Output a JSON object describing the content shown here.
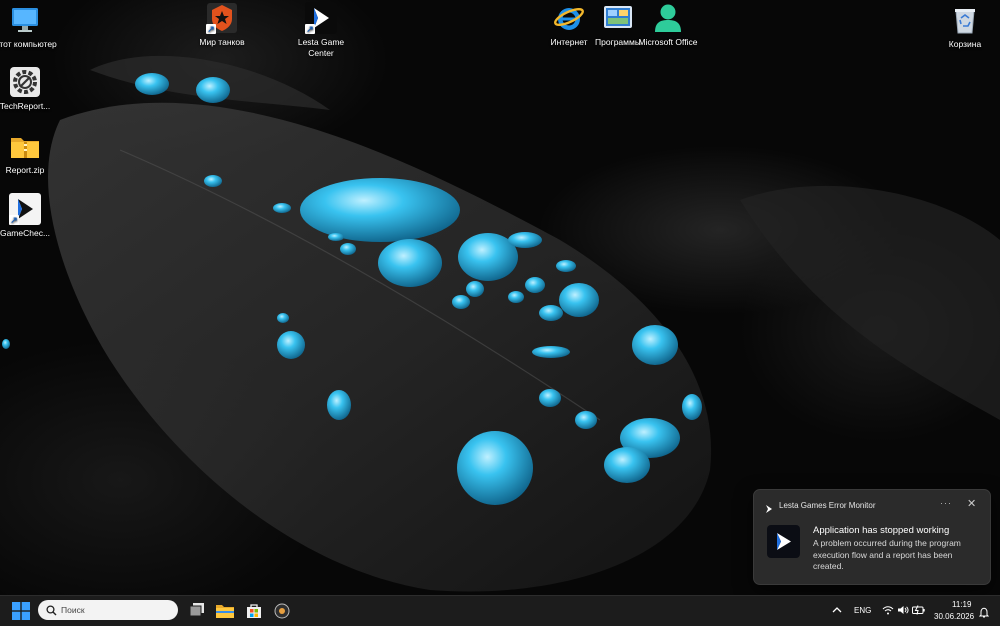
{
  "desktop": {
    "icons": [
      {
        "label": "Этот компьютер",
        "icon": "monitor-icon"
      },
      {
        "label": "TechReport...",
        "icon": "gear-app-icon"
      },
      {
        "label": "Report.zip",
        "icon": "zip-folder-icon"
      },
      {
        "label": "GameChec...",
        "icon": "lesta-arrow-icon"
      },
      {
        "label": "Мир танков",
        "icon": "tank-game-icon"
      },
      {
        "label": "Lesta Game Center",
        "icon": "lesta-arrow-icon"
      },
      {
        "label": "Интернет",
        "icon": "internet-explorer-icon"
      },
      {
        "label": "Программы",
        "icon": "programs-icon"
      },
      {
        "label": "Microsoft Office",
        "icon": "office-user-icon"
      },
      {
        "label": "Корзина",
        "icon": "recycle-bin-icon"
      }
    ]
  },
  "notification": {
    "app_name": "Lesta Games Error Monitor",
    "more": "···",
    "close": "✕",
    "title": "Application has stopped working",
    "message": "A problem occurred during the program execution flow and a report has been created."
  },
  "taskbar": {
    "search_placeholder": "Поиск",
    "language": "ENG",
    "time": "11:19",
    "date": "30.06.2026",
    "accent": "#0a84ff"
  }
}
